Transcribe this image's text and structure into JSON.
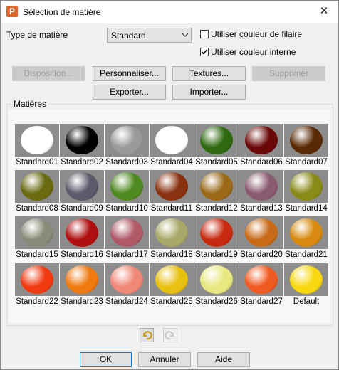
{
  "window": {
    "title": "Sélection de matière",
    "close_glyph": "✕",
    "app_icon_letter": "P"
  },
  "type": {
    "label": "Type de matière",
    "value": "Standard"
  },
  "options": {
    "wire_color_label": "Utiliser couleur de filaire",
    "wire_color_checked": false,
    "internal_color_label": "Utiliser couleur interne",
    "internal_color_checked": true
  },
  "buttons": {
    "disposition": "Disposition...",
    "personnaliser": "Personnaliser...",
    "textures": "Textures...",
    "supprimer": "Supprimer",
    "exporter": "Exporter...",
    "importer": "Importer..."
  },
  "materials_group_label": "Matières",
  "materials": [
    {
      "name": "Standard01",
      "color": "#ffffff"
    },
    {
      "name": "Standard02",
      "color": "#000000"
    },
    {
      "name": "Standard03",
      "color": "#9a9a9a"
    },
    {
      "name": "Standard04",
      "color": "#ffffff"
    },
    {
      "name": "Standard05",
      "color": "#2f6a10"
    },
    {
      "name": "Standard06",
      "color": "#6a0808"
    },
    {
      "name": "Standard07",
      "color": "#5a2a05"
    },
    {
      "name": "Standard08",
      "color": "#6a6a10"
    },
    {
      "name": "Standard09",
      "color": "#5a5a6a"
    },
    {
      "name": "Standard10",
      "color": "#4e8a20"
    },
    {
      "name": "Standard11",
      "color": "#8a3210"
    },
    {
      "name": "Standard12",
      "color": "#9a6a18"
    },
    {
      "name": "Standard13",
      "color": "#8a5a70"
    },
    {
      "name": "Standard14",
      "color": "#8a8a18"
    },
    {
      "name": "Standard15",
      "color": "#8a8a78"
    },
    {
      "name": "Standard16",
      "color": "#b01010"
    },
    {
      "name": "Standard17",
      "color": "#b05a68"
    },
    {
      "name": "Standard18",
      "color": "#a8a868"
    },
    {
      "name": "Standard19",
      "color": "#c82a10"
    },
    {
      "name": "Standard20",
      "color": "#c86a18"
    },
    {
      "name": "Standard21",
      "color": "#d88a10"
    },
    {
      "name": "Standard22",
      "color": "#f03a10"
    },
    {
      "name": "Standard23",
      "color": "#f07a10"
    },
    {
      "name": "Standard24",
      "color": "#f08878"
    },
    {
      "name": "Standard25",
      "color": "#e8c010"
    },
    {
      "name": "Standard26",
      "color": "#e8e880"
    },
    {
      "name": "Standard27",
      "color": "#f05a20"
    },
    {
      "name": "Default",
      "color": "#f8d810"
    }
  ],
  "footer": {
    "ok": "OK",
    "cancel": "Annuler",
    "help": "Aide"
  },
  "icons": {
    "undo": "undo-icon",
    "redo": "redo-icon"
  }
}
